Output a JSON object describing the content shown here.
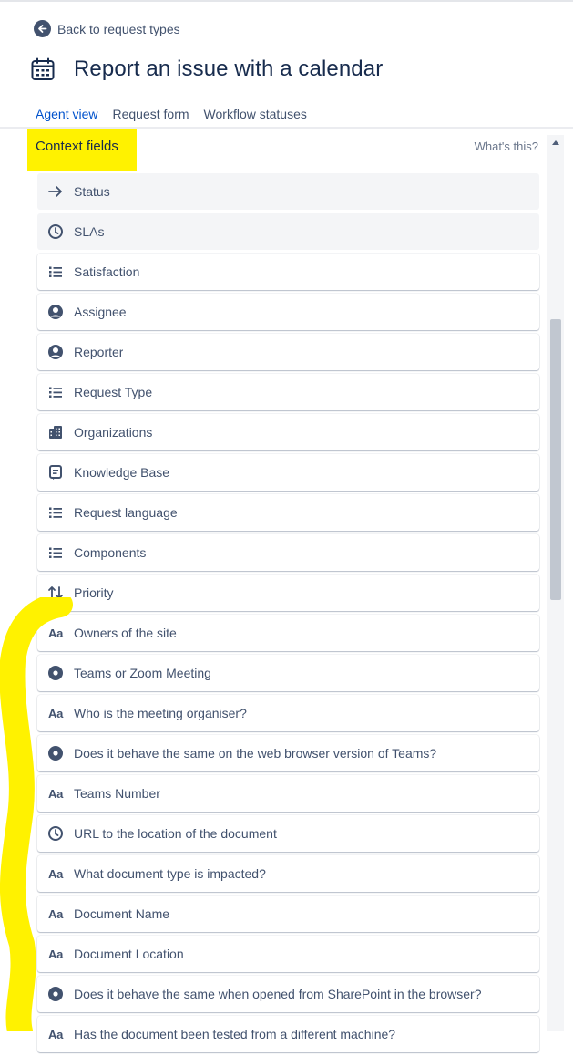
{
  "back": {
    "label": "Back to request types"
  },
  "page": {
    "title": "Report an issue with a calendar"
  },
  "tabs": [
    {
      "label": "Agent view",
      "active": true
    },
    {
      "label": "Request form",
      "active": false
    },
    {
      "label": "Workflow statuses",
      "active": false
    }
  ],
  "section": {
    "title": "Context fields",
    "help_link": "What's this?"
  },
  "fields": [
    {
      "label": "Status",
      "icon": "arrow-right-icon",
      "locked": true
    },
    {
      "label": "SLAs",
      "icon": "clock-icon",
      "locked": true
    },
    {
      "label": "Satisfaction",
      "icon": "list-icon"
    },
    {
      "label": "Assignee",
      "icon": "user-avatar-icon"
    },
    {
      "label": "Reporter",
      "icon": "user-avatar-icon"
    },
    {
      "label": "Request Type",
      "icon": "list-icon"
    },
    {
      "label": "Organizations",
      "icon": "building-icon"
    },
    {
      "label": "Knowledge Base",
      "icon": "document-icon"
    },
    {
      "label": "Request language",
      "icon": "list-icon"
    },
    {
      "label": "Components",
      "icon": "list-icon"
    },
    {
      "label": "Priority",
      "icon": "priority-icon"
    },
    {
      "label": "Owners of the site",
      "icon": "text-field-icon"
    },
    {
      "label": "Teams or Zoom Meeting",
      "icon": "radio-icon"
    },
    {
      "label": "Who is the meeting organiser?",
      "icon": "text-field-icon"
    },
    {
      "label": "Does it behave the same on the web browser version of Teams?",
      "icon": "radio-icon"
    },
    {
      "label": "Teams Number",
      "icon": "text-field-icon"
    },
    {
      "label": "URL to the location of the document",
      "icon": "clock-icon"
    },
    {
      "label": "What document type is impacted?",
      "icon": "text-field-icon"
    },
    {
      "label": "Document Name",
      "icon": "text-field-icon"
    },
    {
      "label": "Document Location",
      "icon": "text-field-icon"
    },
    {
      "label": "Does it behave the same when opened from SharePoint in the browser?",
      "icon": "radio-icon"
    },
    {
      "label": "Has the document been tested from a different machine?",
      "icon": "text-field-icon"
    }
  ],
  "colors": {
    "accent": "#0052cc",
    "text": "#172b4d",
    "subtle": "#42526e",
    "highlight": "#fff200"
  }
}
